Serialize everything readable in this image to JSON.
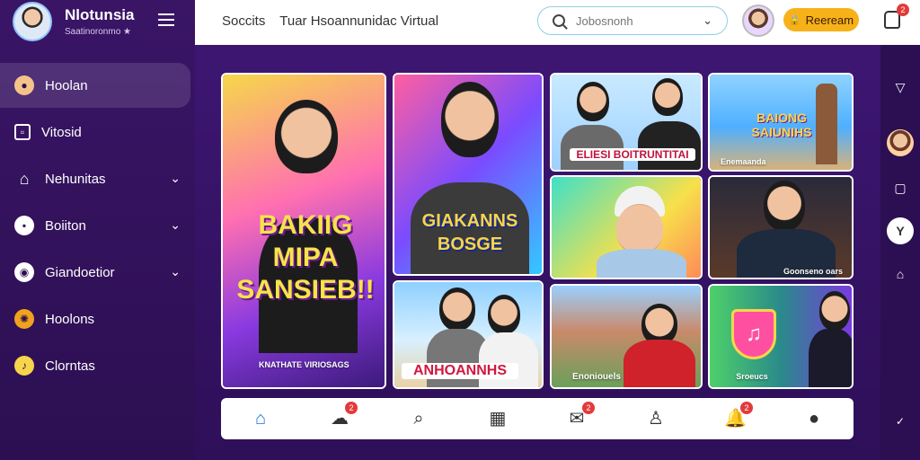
{
  "sidebar": {
    "brand": "Nlotunsia",
    "brand_sub": "Saatinoronmo ★",
    "items": [
      {
        "label": "Hoolan",
        "icon": "orb-icon",
        "active": true,
        "chevron": false
      },
      {
        "label": "Vitosid",
        "icon": "square-icon",
        "active": false,
        "chevron": false
      },
      {
        "label": "Nehunitas",
        "icon": "house-icon",
        "active": false,
        "chevron": true
      },
      {
        "label": "Boiiton",
        "icon": "bag-icon",
        "active": false,
        "chevron": true
      },
      {
        "label": "Giandoetior",
        "icon": "location-icon",
        "active": false,
        "chevron": true
      },
      {
        "label": "Hoolons",
        "icon": "gear-icon",
        "active": false,
        "chevron": false
      },
      {
        "label": "Clorntas",
        "icon": "music-icon",
        "active": false,
        "chevron": false
      }
    ]
  },
  "topbar": {
    "link_1": "Soccits",
    "link_2": "Tuar Hsoannunidac Virtual",
    "search_placeholder": "Jobosnonh",
    "button_label": "Reeream",
    "notification_count": "2"
  },
  "cards": [
    {
      "label": "BAKIIG MIPA SANSIEB!!",
      "caption": "KNATHATE VIRIOSAGS"
    },
    {
      "label": "GIAKANNS BOSGE",
      "caption": ""
    },
    {
      "label": "ELIESI BOITRUNTITAI",
      "caption": ""
    },
    {
      "label": "BAIONG SAIUNIHS",
      "caption": "Enemaanda"
    },
    {
      "label": "",
      "caption": ""
    },
    {
      "label": "",
      "caption": "Goonseno oars"
    },
    {
      "label": "ANHOANNHS",
      "caption": ""
    },
    {
      "label": "",
      "caption": "Enoniouels"
    },
    {
      "label": "",
      "caption": "Sroeucs"
    }
  ],
  "bottom_nav": {
    "badges": [
      "2",
      "2",
      "2"
    ]
  },
  "colors": {
    "accent": "#f7b21a",
    "sidebar": "#3a1566",
    "badge": "#e23b3b",
    "home": "#1e6fe0"
  }
}
